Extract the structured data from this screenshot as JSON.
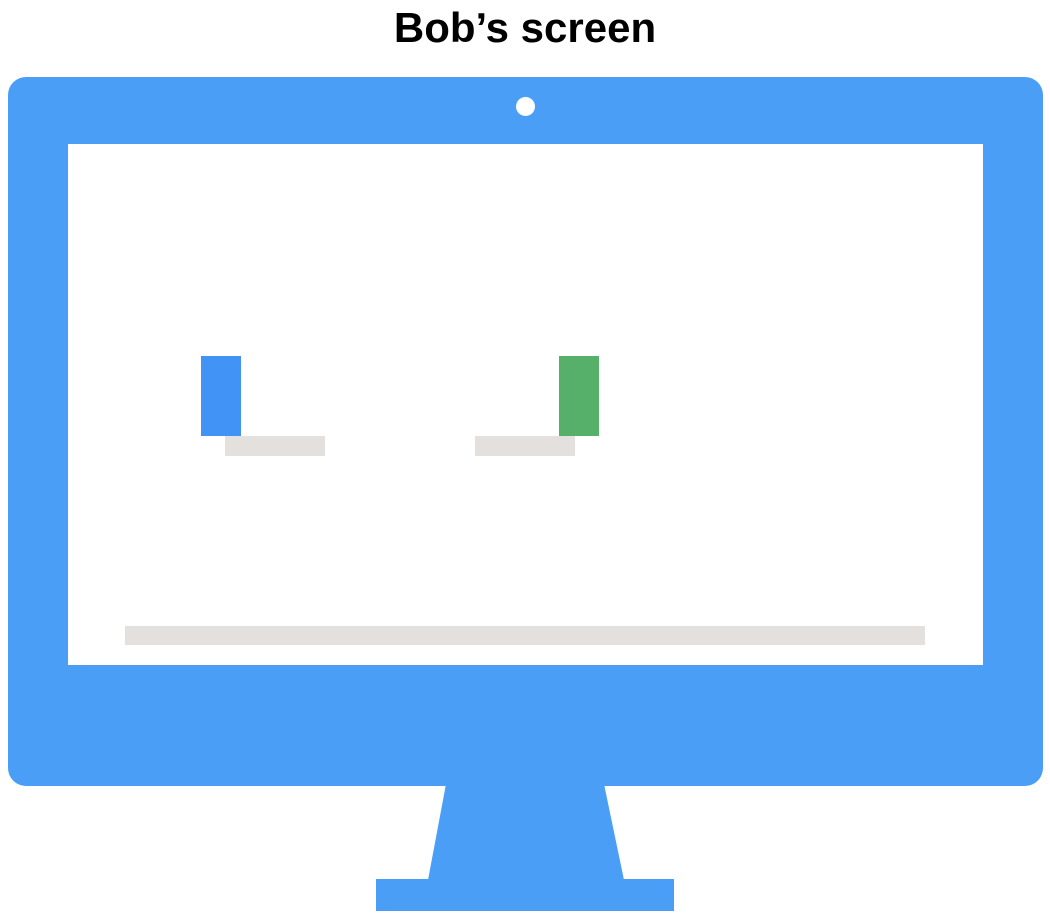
{
  "title": "Bob’s screen",
  "colors": {
    "monitor": "#4a9ef6",
    "screen": "#ffffff",
    "shelf": "#e3e0dd",
    "left_block": "#4193f5",
    "right_block": "#57b06a"
  },
  "elements": {
    "left_block": {
      "color": "blue"
    },
    "right_block": {
      "color": "green"
    }
  }
}
